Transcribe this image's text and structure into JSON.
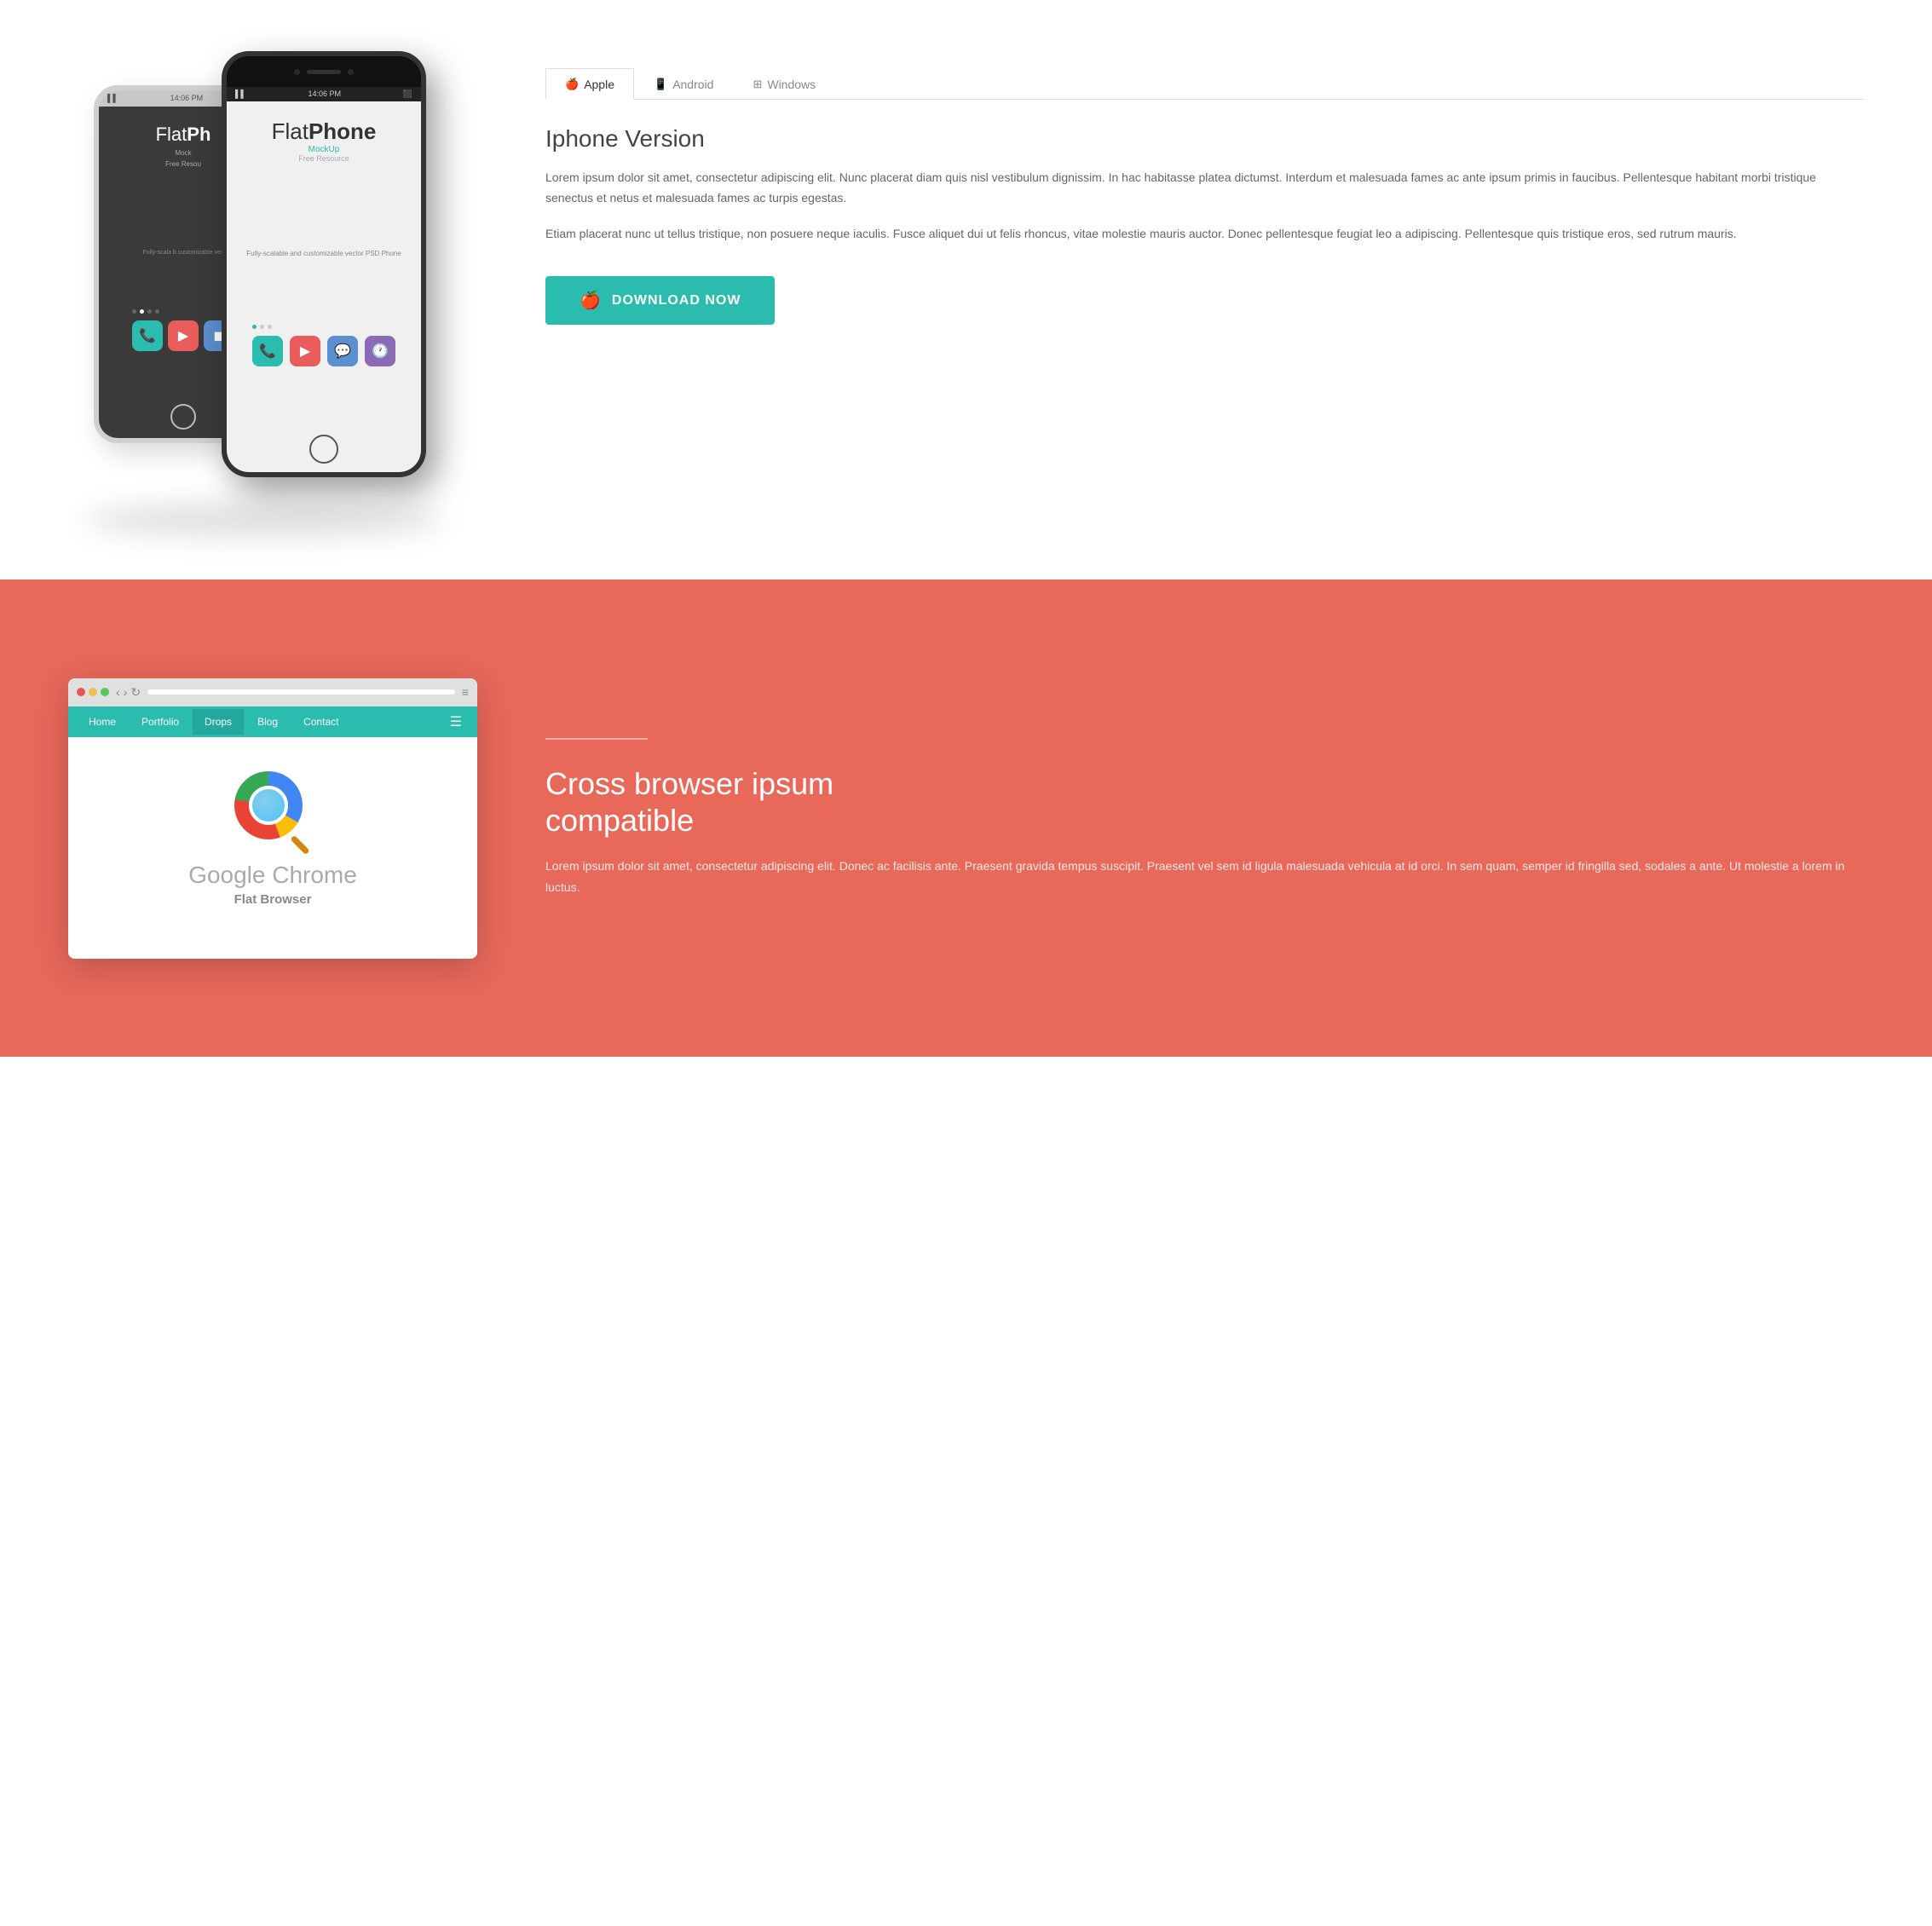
{
  "tabs": {
    "items": [
      {
        "id": "apple",
        "label": "Apple",
        "icon": "🍎",
        "active": true
      },
      {
        "id": "android",
        "label": "Android",
        "icon": "📱",
        "active": false
      },
      {
        "id": "windows",
        "label": "Windows",
        "icon": "⊞",
        "active": false
      }
    ]
  },
  "top_section": {
    "phone_white": {
      "status_time": "14:06 PM",
      "app_title_light": "Flat",
      "app_title_bold": "Ph",
      "app_subtitle": "Mock",
      "app_free": "Free Resou",
      "app_desc": "Fully-scala b\ncustomizable vec",
      "dots": [
        false,
        true,
        false,
        false
      ]
    },
    "phone_black": {
      "status_time": "14:06 PM",
      "status_battery": "□",
      "app_title_light": "Flat",
      "app_title_bold": "Phone",
      "app_subtitle": "MockUp",
      "app_free": "Free Resource",
      "app_desc": "Fully-scalable and\ncustomizable vector PSD Phone",
      "dots": [
        true,
        false,
        false
      ]
    }
  },
  "right_content": {
    "section_title": "Iphone Version",
    "paragraph_1": "Lorem ipsum dolor sit amet, consectetur adipiscing elit. Nunc placerat diam quis nisl vestibulum dignissim. In hac habitasse platea dictumst. Interdum et malesuada fames ac ante ipsum primis in faucibus. Pellentesque habitant morbi tristique senectus et netus et malesuada fames ac turpis egestas.",
    "paragraph_2": "Etiam placerat nunc ut tellus tristique, non posuere neque iaculis. Fusce aliquet dui ut felis rhoncus, vitae molestie mauris auctor. Donec pellentesque feugiat leo a adipiscing. Pellentesque quis tristique eros, sed rutrum mauris.",
    "download_button": "DOWNLOAD NOW"
  },
  "bottom_section": {
    "browser": {
      "dots": [
        "red",
        "yellow",
        "green"
      ],
      "url_placeholder": "",
      "nav_items": [
        "Home",
        "Portfolio",
        "Drops",
        "Blog",
        "Contact"
      ],
      "active_nav": "Drops",
      "browser_title": "Google Chrome",
      "browser_subtitle": "Flat Browser"
    },
    "right": {
      "divider": true,
      "title_line1": "Cross browser ipsum",
      "title_line2": "compatible",
      "description": "Lorem ipsum dolor sit amet, consectetur adipiscing elit. Donec ac facilisis ante. Praesent gravida tempus suscipit. Praesent vel sem id ligula malesuada vehicula at id orci. In sem quam, semper id fringilla sed, sodales a ante. Ut molestie a lorem in luctus."
    }
  },
  "colors": {
    "teal": "#2bbcb0",
    "salmon": "#e8685a",
    "white": "#ffffff",
    "dark_text": "#444444",
    "light_text": "#666666"
  }
}
